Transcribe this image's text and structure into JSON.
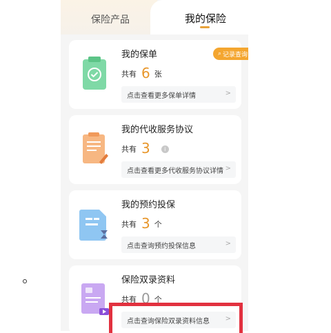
{
  "tabs": {
    "left": "保险产品",
    "right": "我的保险",
    "accent": "#e8a23a"
  },
  "record_button": {
    "label": "记录查询",
    "icon": "search-icon"
  },
  "cards": [
    {
      "title": "我的保单",
      "prefix": "共有",
      "count": "6",
      "unit": "张",
      "link": "点击查看更多保单详情",
      "icon": "policy-clipboard-icon"
    },
    {
      "title": "我的代收服务协议",
      "prefix": "共有",
      "count": "3",
      "unit": "",
      "link": "点击查看更多代收服务协议详情",
      "icon": "agreement-document-icon"
    },
    {
      "title": "我的预约投保",
      "prefix": "共有",
      "count": "3",
      "unit": "个",
      "link": "点击查询预约投保信息",
      "icon": "reservation-icon"
    },
    {
      "title": "保险双录资料",
      "prefix": "共有",
      "count": "0",
      "unit": "个",
      "link": "点击查询保险双录资料信息",
      "icon": "video-record-icon"
    }
  ],
  "chevron": ">",
  "info_glyph": "i"
}
